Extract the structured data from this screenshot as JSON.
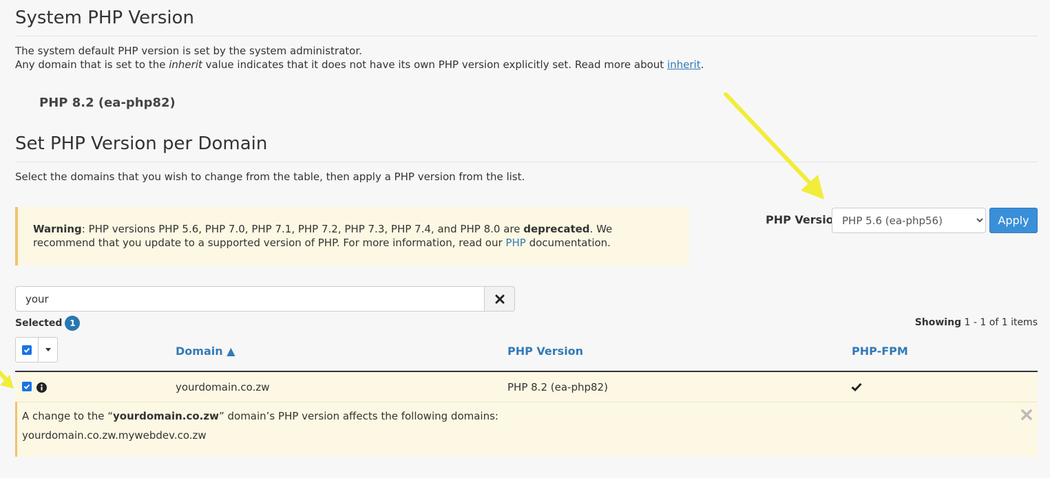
{
  "system_section": {
    "title": "System PHP Version",
    "line1": "The system default PHP version is set by the system administrator.",
    "line2_pre": "Any domain that is set to the ",
    "line2_em": "inherit",
    "line2_mid": " value indicates that it does not have its own PHP version explicitly set. Read more about ",
    "line2_link": "inherit",
    "line2_end": ".",
    "current_version": "PHP 8.2 (ea-php82)"
  },
  "domain_section": {
    "title": "Set PHP Version per Domain",
    "description": "Select the domains that you wish to change from the table, then apply a PHP version from the list."
  },
  "warning": {
    "label": "Warning",
    "text_a": ": PHP versions PHP 5.6, PHP 7.0, PHP 7.1, PHP 7.2, PHP 7.3, PHP 7.4, and PHP 8.0 are ",
    "deprecated": "deprecated",
    "text_b": ". We recommend that you update to a supported version of PHP. For more information, read our ",
    "link": "PHP",
    "text_c": " documentation."
  },
  "version_control": {
    "label": "PHP Version",
    "selected": "PHP 5.6 (ea-php56)",
    "apply_label": "Apply"
  },
  "search": {
    "value": "your"
  },
  "selection": {
    "label": "Selected",
    "count": "1",
    "showing_label": "Showing",
    "showing_range": "1 - 1 of 1 items"
  },
  "table": {
    "columns": {
      "domain": "Domain ▲",
      "php_version": "PHP Version",
      "php_fpm": "PHP-FPM"
    },
    "rows": [
      {
        "domain": "yourdomain.co.zw",
        "php_version": "PHP 8.2 (ea-php82)",
        "fpm_enabled": true
      }
    ]
  },
  "detail": {
    "text_pre": "A change to the “",
    "domain": "yourdomain.co.zw",
    "text_post": "” domain’s PHP version affects the following domains:",
    "affected": "yourdomain.co.zw.mywebdev.co.zw"
  },
  "colors": {
    "accent": "#337ab7",
    "warning_bg": "#fcf8e3",
    "arrow": "#f2ec3a"
  }
}
